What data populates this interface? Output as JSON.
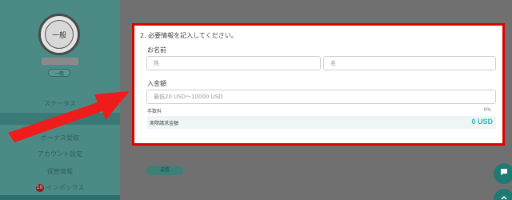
{
  "sidebar": {
    "avatar_text": "一般",
    "rank_label": "一般",
    "items": [
      {
        "label": "ステータス"
      },
      {
        "label": "ボーナス受取"
      },
      {
        "label": "アカウント設定"
      },
      {
        "label": "保管情報"
      },
      {
        "label": "インボックス",
        "badge": "10"
      }
    ]
  },
  "form": {
    "step_title": "2. 必要情報を記入してください。",
    "name_label": "お名前",
    "last_name_placeholder": "姓",
    "first_name_placeholder": "名",
    "amount_label": "入金額",
    "amount_placeholder": "最低20 USD〜10000 USD",
    "fee_label": "手数料",
    "fee_value": "0%",
    "total_label": "実際請求金額",
    "total_value": "0 USD"
  },
  "main": {
    "submit_label": "送信"
  },
  "colors": {
    "highlight_border": "#e00000",
    "accent": "#2bb8b0",
    "sidebar": "#4c8a86"
  }
}
